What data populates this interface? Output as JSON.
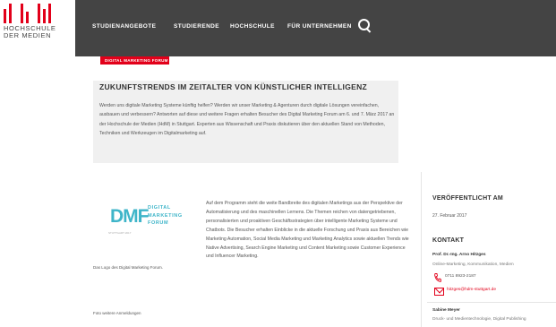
{
  "header": {
    "logo_line1": "HOCHSCHULE",
    "logo_line2": "DER MEDIEN",
    "nav_items": [
      {
        "label": "STUDIENANGEBOTE"
      },
      {
        "label": "STUDIERENDE"
      },
      {
        "label": "HOCHSCHULE"
      },
      {
        "label": "FÜR UNTERNEHMEN"
      }
    ]
  },
  "article": {
    "tag": "DIGITAL MARKETING FORUM",
    "title": "ZUKUNFTSTRENDS IM ZEITALTER VON KÜNSTLICHER INTELLIGENZ",
    "lead": "Werden uns digitale Marketing Systeme künftig helfen? Werden wir unser Marketing & Agenturen durch digitale Lösungen vereinfachen, ausbauen und verbessern? Antworten auf diese und weitere Fragen erhalten Besucher des Digital Marketing Forum am 6. und 7. März 2017 an der Hochschule der Medien (HdM) in Stuttgart. Experten aus Wissenschaft und Praxis diskutieren über den aktuellen Stand von Methoden, Techniken und Werkzeugen im Digitalmarketing auf.",
    "body": "Auf dem Programm steht die weite Bandbreite des digitalen Marketings aus der Perspektive der Automatisierung und des maschinellen Lernens. Die Themen reichen von datengetriebenen, personalisierten und proaktiven Geschäftsstrategien über intelligente Marketing Systeme und Chatbots. Die Besucher erhalten Einblicke in die aktuelle Forschung und Praxis aus Bereichen wie Marketing Automation, Social Media Marketing und Marketing Analytics sowie aktuellen Trends wie Native Advertising, Search Engine Marketing und Content Marketing sowie Customer Experience und Influencer Marketing.",
    "logo_lines": [
      "DIGITAL",
      "MARKETING",
      "FORUM"
    ],
    "logo_letters": "DMF",
    "logo_sub": "STUTTGART 2017",
    "caption": "Das Logo des Digital Marketing Forum.",
    "photo_credit": "Foto weitere Anmeldungen"
  },
  "sidebar": {
    "published_heading": "VERÖFFENTLICHT AM",
    "published_date": "27. Februar 2017",
    "contact_heading": "KONTAKT",
    "contact_name": "Prof. Dr.-Ing. Arno Hitzges",
    "contact_role": "Online-Marketing, Kommunikation, Medien",
    "contact_phone": "0711 8923-2187",
    "contact_email": "hitzges@hdm-stuttgart.de",
    "contact2_name": "Sabine Meyer",
    "contact2_role": "Druck- und Medientechnologie, Digital Publishing"
  },
  "colors": {
    "accent": "#e2001a",
    "nav_bg": "#444444",
    "logo_cyan": "#3fb5c9",
    "hero_bg": "#f0f0f0"
  }
}
